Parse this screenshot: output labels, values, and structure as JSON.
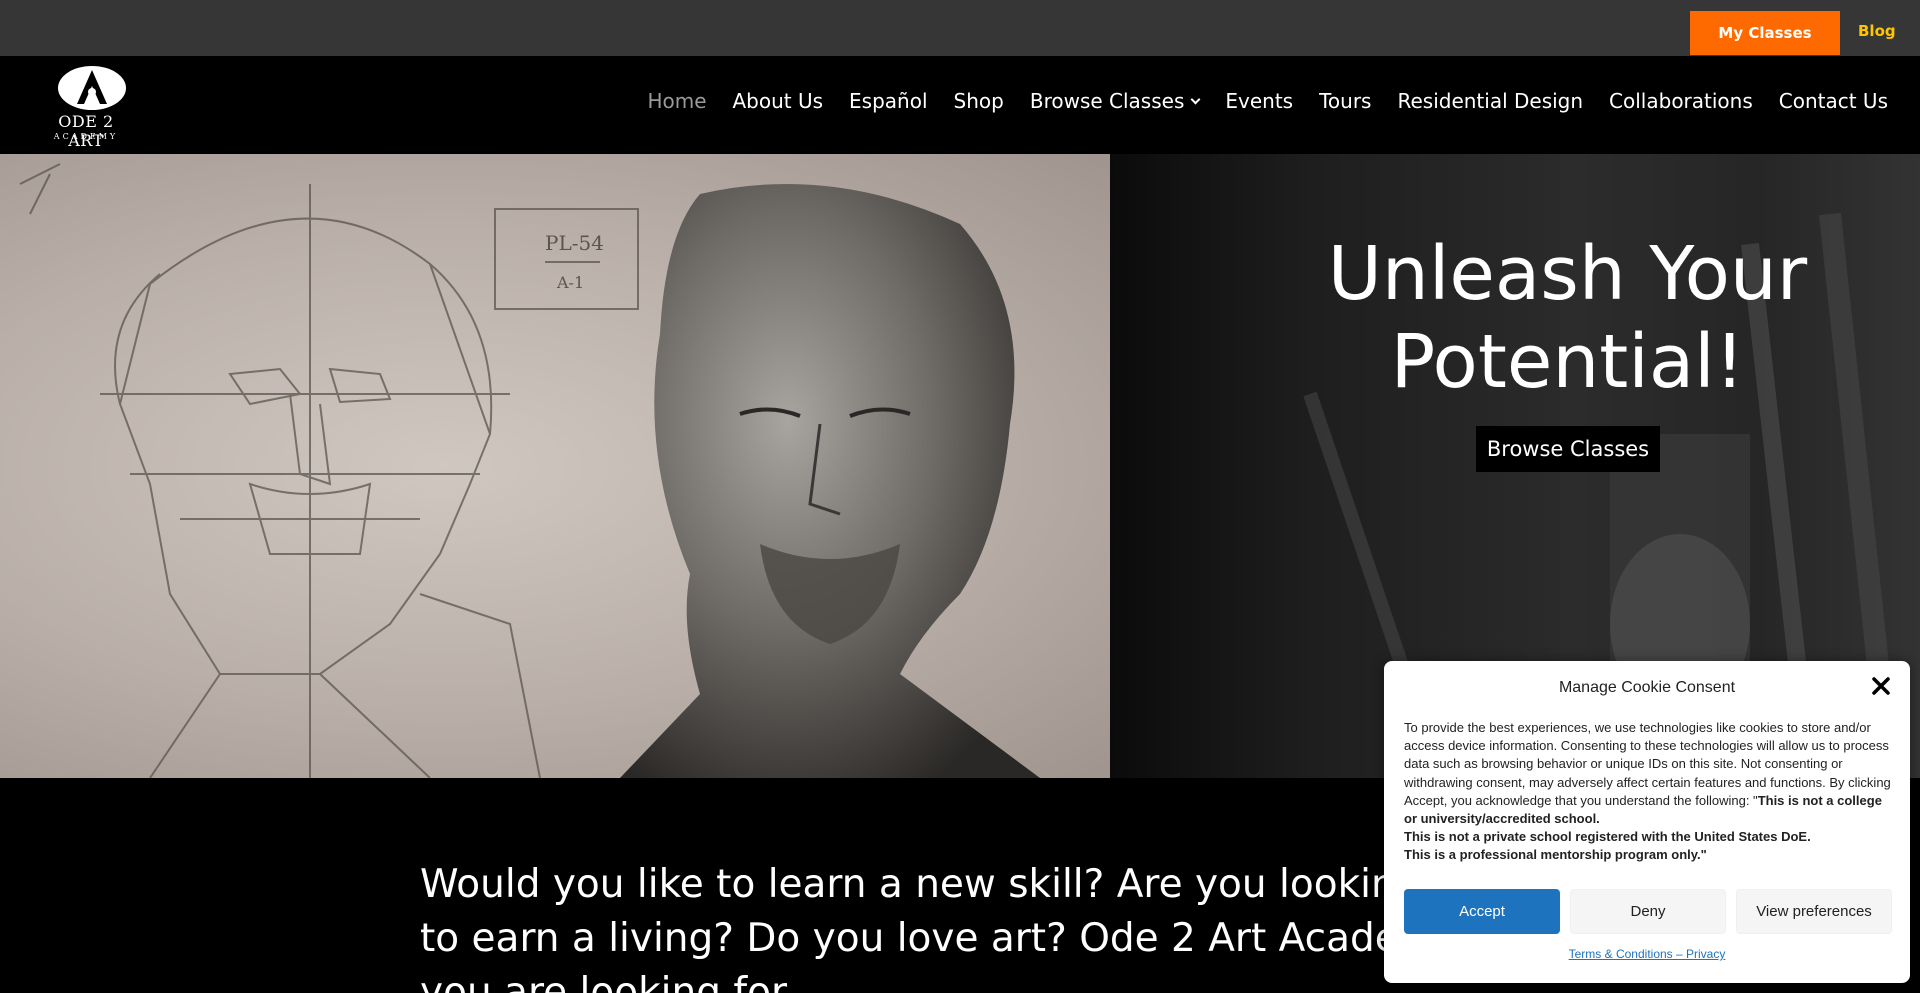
{
  "topbar": {
    "my_classes": "My Classes",
    "blog": "Blog",
    "colors": {
      "bg": "#363636",
      "accent": "#ff6a00",
      "link": "#ffc600"
    }
  },
  "header": {
    "logo": {
      "name": "ODE 2 ART",
      "sub": "ACADEMY"
    },
    "nav": [
      {
        "label": "Home",
        "active": true
      },
      {
        "label": "About Us"
      },
      {
        "label": "Español"
      },
      {
        "label": "Shop"
      },
      {
        "label": "Browse Classes",
        "dropdown": true
      },
      {
        "label": "Events"
      },
      {
        "label": "Tours"
      },
      {
        "label": "Residential Design"
      },
      {
        "label": "Collaborations"
      },
      {
        "label": "Contact Us"
      }
    ]
  },
  "hero": {
    "title_line1": "Unleash Your",
    "title_line2": "Potential!",
    "button": "Browse Classes",
    "drawing_label_top": "PL-54",
    "drawing_label_bottom": "A-1"
  },
  "intro": {
    "text": "Would you like to learn a new skill? Are you looking for a way to earn a living? Do you love art? Ode 2 Art Academy is what you are looking for."
  },
  "cookie": {
    "title": "Manage Cookie Consent",
    "body": "To provide the best experiences, we use technologies like cookies to store and/or access device information. Consenting to these technologies will allow us to process data such as browsing behavior or unique IDs on this site. Not consenting or withdrawing consent, may adversely affect certain features and functions. By clicking Accept, you acknowledge that you understand the following: \"",
    "bold1": "This is not a college or university/accredited school.",
    "bold2": "This is not a private school registered with the United States DoE.",
    "bold3": "This is a professional mentorship program only.\"",
    "accept": "Accept",
    "deny": "Deny",
    "preferences": "View preferences",
    "link": "Terms & Conditions – Privacy",
    "colors": {
      "accept": "#1e73be"
    }
  }
}
